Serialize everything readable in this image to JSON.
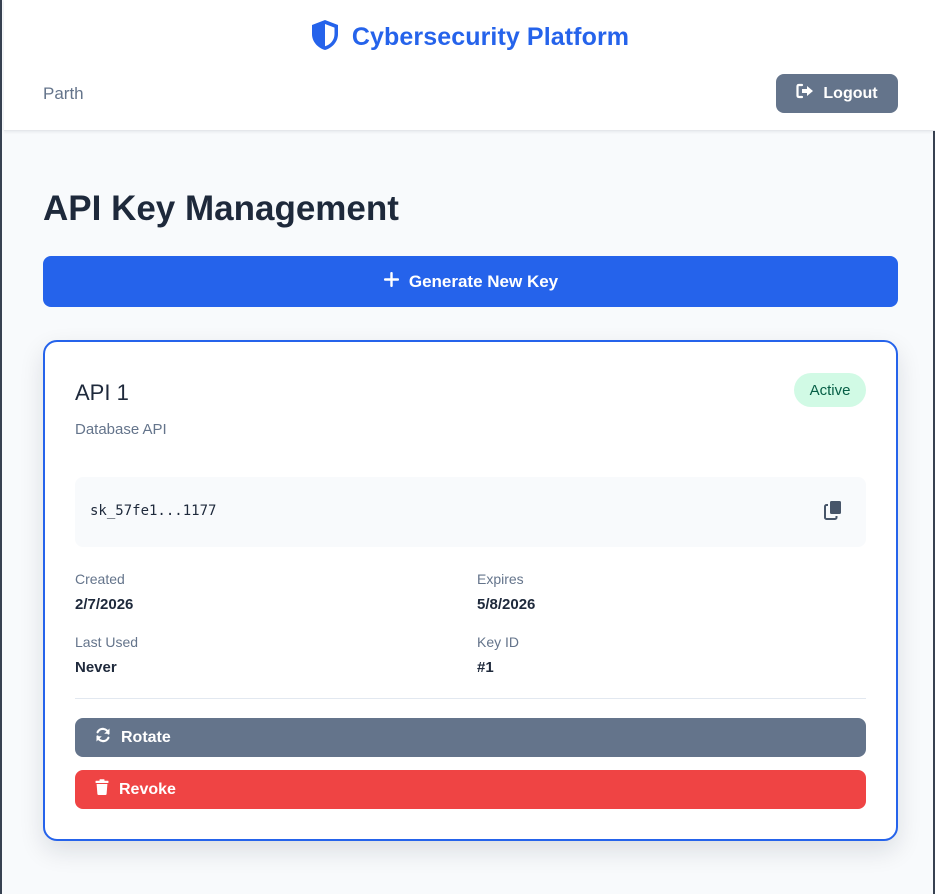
{
  "header": {
    "brand_title": "Cybersecurity Platform",
    "brand_icon": "shield-icon",
    "user_name": "Parth",
    "logout_label": "Logout",
    "logout_icon": "sign-out-icon"
  },
  "main": {
    "page_title": "API Key Management",
    "generate_label": "Generate New Key",
    "generate_icon": "plus-icon"
  },
  "api_keys": [
    {
      "name": "API 1",
      "description": "Database API",
      "status": "Active",
      "key_masked": "sk_57fe1...1177",
      "created_label": "Created",
      "created_value": "2/7/2026",
      "expires_label": "Expires",
      "expires_value": "5/8/2026",
      "last_used_label": "Last Used",
      "last_used_value": "Never",
      "key_id_label": "Key ID",
      "key_id_value": "#1",
      "rotate_label": "Rotate",
      "revoke_label": "Revoke"
    }
  ],
  "colors": {
    "primary": "#2563eb",
    "secondary": "#64748b",
    "danger": "#ef4444",
    "success_bg": "#d1fae5",
    "success_text": "#065f46"
  }
}
